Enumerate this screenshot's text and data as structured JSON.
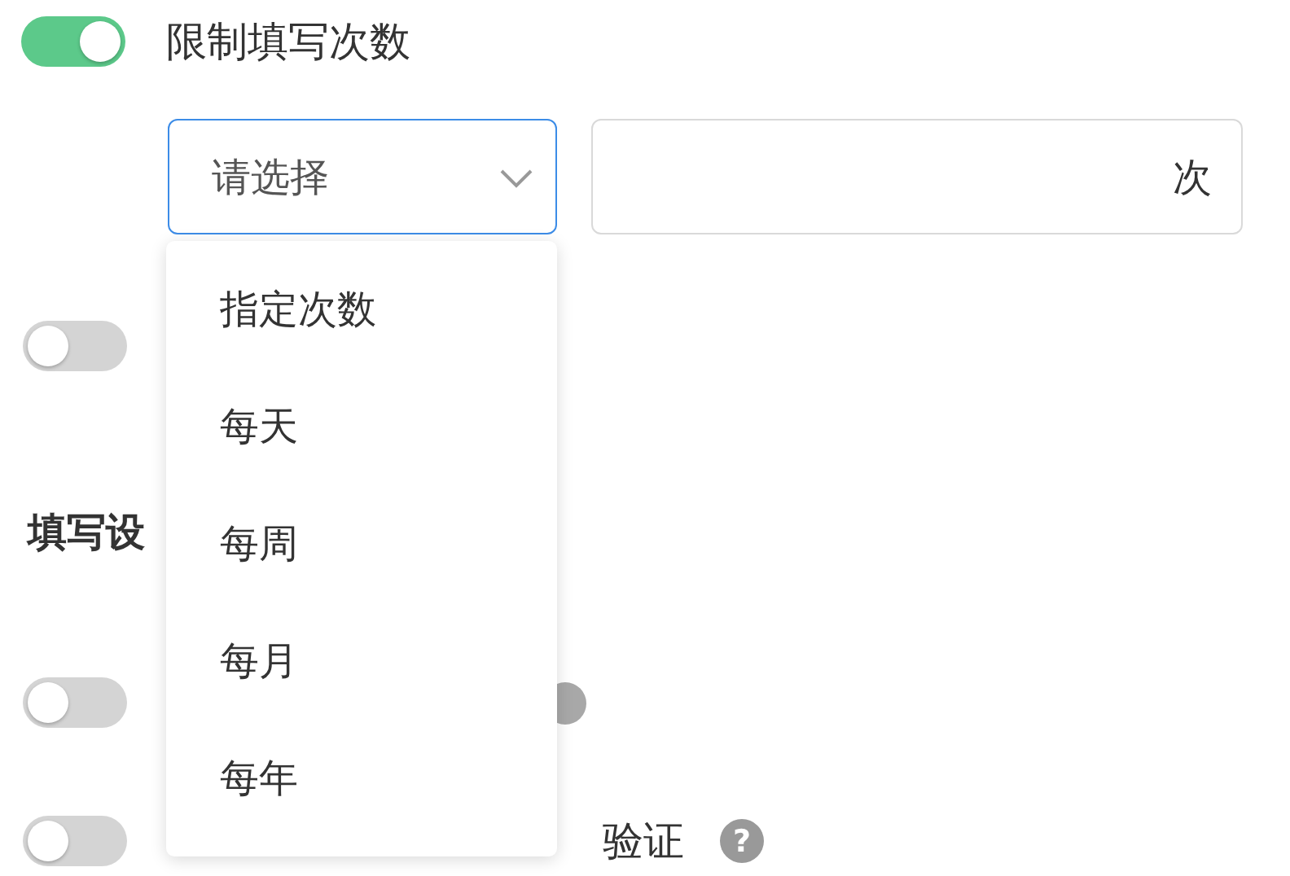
{
  "limit_toggle": {
    "label": "限制填写次数",
    "on": true
  },
  "count_select": {
    "placeholder": "请选择",
    "focused": true
  },
  "count_input": {
    "suffix": "次"
  },
  "dropdown": {
    "items": [
      {
        "label": "指定次数",
        "selected": false
      },
      {
        "label": "每天",
        "selected": false
      },
      {
        "label": "每周",
        "selected": false
      },
      {
        "label": "每月",
        "selected": false
      },
      {
        "label": "每年",
        "selected": false
      }
    ]
  },
  "rows": [
    {
      "kind": "toggle",
      "on": false
    },
    {
      "kind": "heading",
      "label": "填写设"
    },
    {
      "kind": "toggle",
      "on": false,
      "help_circle": true
    },
    {
      "kind": "toggle",
      "on": false,
      "label": "验证",
      "help": "?"
    }
  ]
}
